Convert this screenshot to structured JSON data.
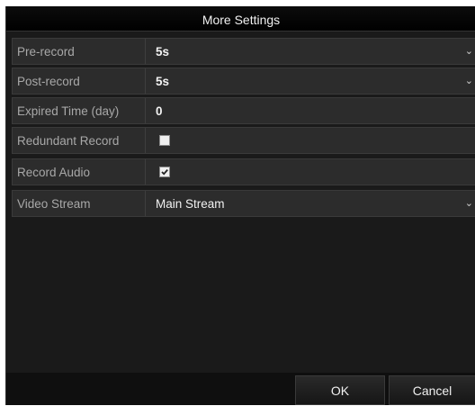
{
  "dialog": {
    "title": "More Settings"
  },
  "settings": {
    "pre_record": {
      "label": "Pre-record",
      "value": "5s"
    },
    "post_record": {
      "label": "Post-record",
      "value": "5s"
    },
    "expired_time": {
      "label": "Expired Time (day)",
      "value": "0"
    },
    "redundant_record": {
      "label": "Redundant Record",
      "checked": false
    },
    "record_audio": {
      "label": "Record Audio",
      "checked": true
    },
    "video_stream": {
      "label": "Video Stream",
      "value": "Main Stream"
    }
  },
  "icons": {
    "dropdown": "chevron-down-icon",
    "checkbox_checked": "check-icon"
  },
  "buttons": {
    "ok_label": "OK",
    "cancel_label": "Cancel"
  },
  "colors": {
    "background": "#1a1a1a",
    "row_background": "#2c2c2c",
    "label_text": "#a8a8a8",
    "value_text": "#f2f2f2"
  }
}
